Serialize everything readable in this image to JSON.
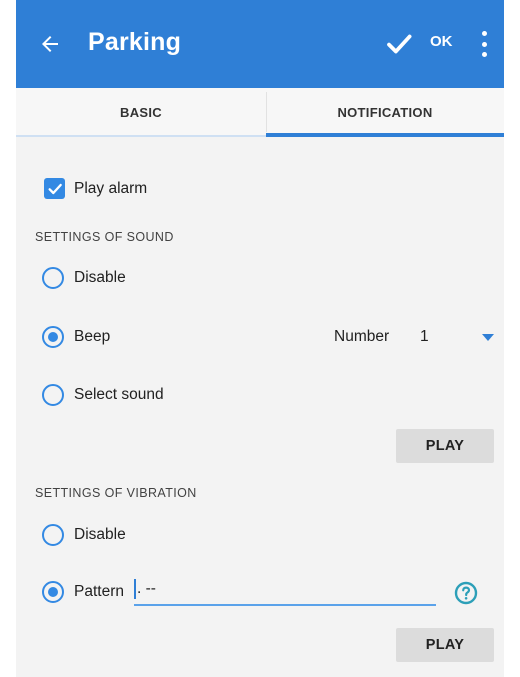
{
  "appbar": {
    "title": "Parking",
    "ok_label": "OK"
  },
  "tabs": [
    {
      "label": "BASIC",
      "selected": false
    },
    {
      "label": "NOTIFICATION",
      "selected": true
    }
  ],
  "play_alarm": {
    "label": "Play alarm",
    "checked": true
  },
  "sound": {
    "section_title": "SETTINGS OF SOUND",
    "options": [
      {
        "label": "Disable",
        "selected": false
      },
      {
        "label": "Beep",
        "selected": true
      },
      {
        "label": "Select sound",
        "selected": false
      }
    ],
    "number_label": "Number",
    "number_value": "1",
    "play_label": "PLAY"
  },
  "vibration": {
    "section_title": "SETTINGS OF VIBRATION",
    "options": [
      {
        "label": "Disable",
        "selected": false
      },
      {
        "label": "Pattern",
        "selected": true
      }
    ],
    "pattern_value": ". --",
    "play_label": "PLAY"
  },
  "colors": {
    "primary": "#2f7fd6",
    "accent": "#3389e3",
    "background": "#f3f3f3",
    "button": "#dcdcdc"
  },
  "icons": {
    "back": "arrow-left-icon",
    "confirm": "check-icon",
    "menu": "more-vertical-icon",
    "help": "help-circle-icon"
  }
}
